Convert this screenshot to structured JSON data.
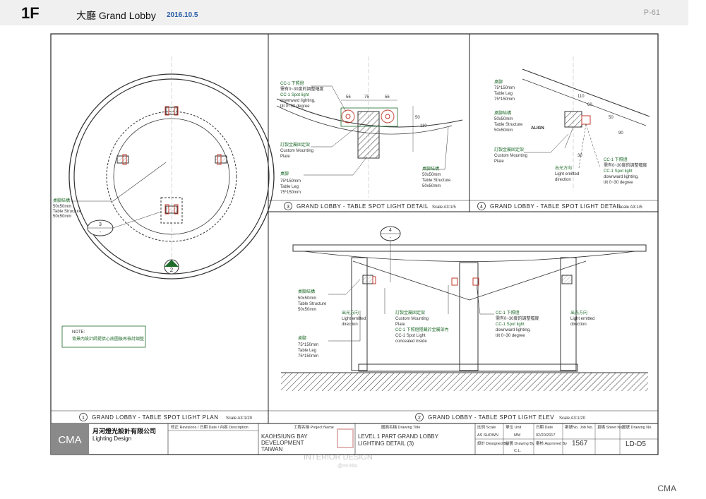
{
  "header": {
    "floor": "1F",
    "title": "大廳 Grand Lobby",
    "date": "2016.10.5",
    "page": "P-61"
  },
  "footer": {
    "brand": "CMA"
  },
  "plan": {
    "ref_number": "3",
    "ref_dash": "-",
    "north_number": "2",
    "label_zh": "桌腳結構",
    "label_en1": "50x50mm",
    "label_en2": "Table Structure",
    "label_en3": "50x50mm",
    "note_title": "NOTE:",
    "note_text": "背景內設計師提供心底圖後再檢討調整",
    "caption_num": "1",
    "caption": "GRAND LOBBY - TABLE SPOT LIGHT PLAN",
    "scale": "Scale A3:1/20"
  },
  "detail3": {
    "cc1_zh": "CC-1 下照燈",
    "cc1_zh2": "需有0~30度的調整幅度",
    "cc1_en1": "CC-1 Spot light",
    "cc1_en2": "downward lighting,",
    "cc1_en3": "tilt 0~30 degree",
    "mount_zh": "訂製金屬固定架",
    "mount_en1": "Custom Mounting",
    "mount_en2": "Plate",
    "leg_zh": "桌腳",
    "leg_en1": "75*150mm",
    "leg_en2": "Table Leg",
    "leg_en3": "75*150mm",
    "struct_zh": "桌腳結構",
    "struct_en1": "50x50mm",
    "struct_en2": "Table Structure",
    "struct_en3": "50x50mm",
    "dim_56a": "56",
    "dim_75": "75",
    "dim_56b": "56",
    "dim_50": "50",
    "dim_110": "110",
    "caption_num": "3",
    "caption": "GRAND LOBBY - TABLE SPOT LIGHT DETAIL",
    "scale": "Scale A3:1/5"
  },
  "detail4": {
    "leg_zh": "桌腳",
    "leg_en1": "75*150mm",
    "leg_en2": "Table Leg",
    "leg_en3": "75*150mm",
    "struct_zh": "桌腳結構",
    "struct_en1": "50x50mm",
    "struct_en2": "Table Structure",
    "struct_en3": "50x50mm",
    "align": "ALIGN",
    "mount_zh": "訂製金屬固定架",
    "mount_en1": "Custom Mounting",
    "mount_en2": "Plate",
    "cc1_zh": "CC-1 下照燈",
    "cc1_zh2": "需有0~30度的調整幅度",
    "cc1_en1": "CC-1 Spot light",
    "cc1_en2": "downward lighting,",
    "cc1_en3": "tilt 0~30 degree",
    "dir_zh": "出光方向",
    "dir_en1": "Light emitted",
    "dir_en2": "direction",
    "dim_110": "110",
    "dim_60": "60",
    "dim_50": "50",
    "dim_30": "30",
    "dim_90": "90",
    "caption_num": "4",
    "caption": "GRAND LOBBY - TABLE SPOT LIGHT DETAIL",
    "scale": "Scale A3:1/5"
  },
  "elev": {
    "ref_number": "4",
    "ref_dash": "-",
    "struct_zh": "桌腳結構",
    "struct_en1": "50x50mm",
    "struct_en2": "Table Structure",
    "struct_en3": "50x50mm",
    "dir_zh": "出光方向",
    "dir_en1": "Light emitted",
    "dir_en2": "direction",
    "leg_zh": "桌腳",
    "leg_en1": "75*150mm",
    "leg_en2": "Table Leg",
    "leg_en3": "75*150mm",
    "mount_zh": "訂製金屬固定架",
    "mount_en1": "Custom Mounting",
    "mount_en2": "Plate",
    "cc1_hidden_zh": "CC-1 下照燈隱藏於金屬架內",
    "cc1_hidden_en1": "CC-1 Spot Light",
    "cc1_hidden_en2": "concealed inside",
    "cc1_zh": "CC-1 下照燈",
    "cc1_zh2": "需有0~30度的調整幅度",
    "cc1_en1": "CC-1 Spot light",
    "cc1_en2": "downward lighting,",
    "cc1_en3": "tilt 0~30 degree",
    "dir2_zh": "出光方向",
    "dir2_en1": "Light emitted",
    "dir2_en2": "direction",
    "caption_num": "2",
    "caption": "GRAND LOBBY - TABLE SPOT LIGHT ELEV",
    "scale": "Scale A3:1/20"
  },
  "titleblock": {
    "logo": "CMA",
    "company_zh": "月河燈光設計有限公司",
    "company_en": "Lighting Design",
    "revisions": "修正 Revisions / 日期 Date / 內容 Description",
    "project_label": "工程名稱 Project Name",
    "project_line1": "KAOHSIUNG BAY",
    "project_line2": "DEVELOPMENT",
    "project_line3": "TAIWAN",
    "drawing_label": "圖面名稱 Drawing Title",
    "drawing_line1": "LEVEL 1 PART GRAND LOBBY",
    "drawing_line2": "LIGHTING DETAIL (3)",
    "scale_label": "比例 Scale",
    "scale_value": "AS SHOWN",
    "unit_label": "單位 Unit",
    "unit_value": "MM",
    "date_label": "日期 Date",
    "date_value": "02/20/2017",
    "job_label": "案號No. Job No.",
    "job_value": "1567",
    "sheet_label": "頁碼 Sheet No.",
    "drawing_no_label": "圖號 Drawing No.",
    "drawing_no_value": "LD-D5",
    "designed_label": "設計 Designed By",
    "drawn_label": "繪圖 Drawing By",
    "drawn_value": "C.L.",
    "approved_label": "審核 Approved By"
  },
  "watermark": {
    "line1": "INTERIOR DESIGN",
    "line2": "@mt-bbs"
  }
}
